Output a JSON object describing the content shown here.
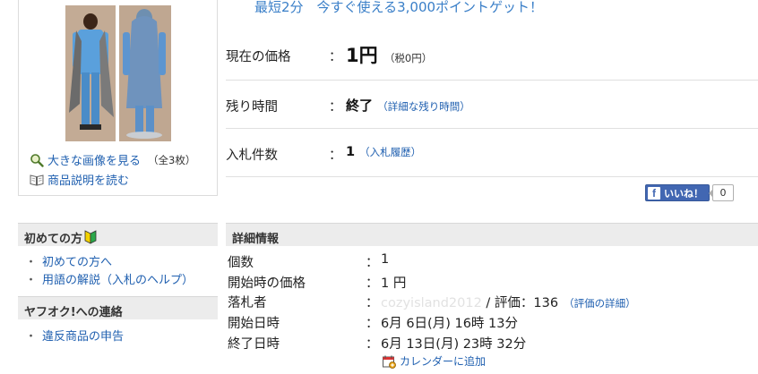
{
  "promo": {
    "text": "最短2分　今すぐ使える3,000ポイントゲット！"
  },
  "image_box": {
    "enlarge_link": "大きな画像を見る",
    "image_count": "（全3枚）",
    "description_link": "商品説明を読む"
  },
  "sidebar": {
    "beginners": {
      "title": "初めての方",
      "items": [
        {
          "label": "初めての方へ"
        },
        {
          "label": "用語の解説（入札のヘルプ）"
        }
      ]
    },
    "contact": {
      "title": "ヤフオク!への連絡",
      "items": [
        {
          "label": "違反商品の申告"
        }
      ]
    },
    "bullet": "・"
  },
  "price": {
    "label": "現在の価格",
    "colon": "：",
    "value": "1円",
    "tax": "（税0円）"
  },
  "remaining": {
    "label": "残り時間",
    "colon": "：",
    "value": "終了",
    "detail_link": "（詳細な残り時間）"
  },
  "bids": {
    "label": "入札件数",
    "colon": "：",
    "value": "1",
    "history_link": "（入札履歴）"
  },
  "like": {
    "label": "いいね！",
    "count": "0",
    "fb_letter": "f"
  },
  "details": {
    "title": "詳細情報",
    "colon": "：",
    "rows": [
      {
        "label": "個数",
        "value": "1"
      },
      {
        "label": "開始時の価格",
        "value": "1 円"
      },
      {
        "label": "落札者",
        "seller": "cozyisland2012",
        "rating_text": " / 評価：136",
        "rating_link": "（評価の詳細）"
      },
      {
        "label": "開始日時",
        "value": "6月 6日(月) 16時 13分"
      },
      {
        "label": "終了日時",
        "value": "6月 13日(月) 23時 32分"
      }
    ],
    "calendar_link": "カレンダーに追加"
  },
  "colors": {
    "link": "#2060b0",
    "promo": "#3a7fc8",
    "panel_bg": "#ececec",
    "fb_blue": "#4267b2"
  }
}
